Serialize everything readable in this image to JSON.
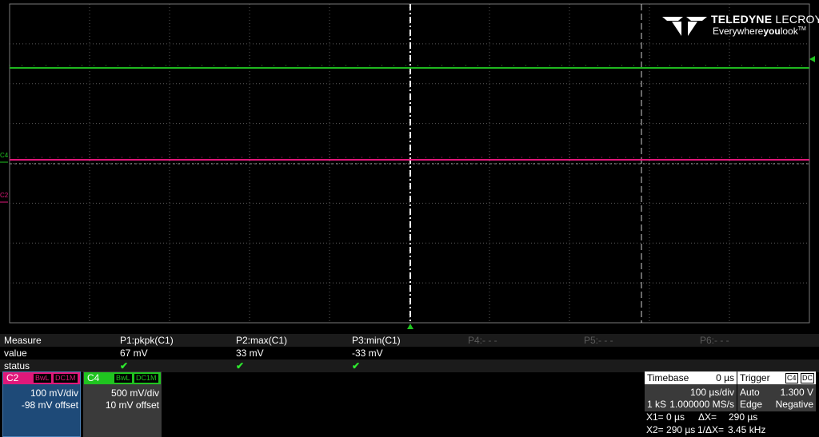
{
  "logo": {
    "brand_bold": "TELEDYNE",
    "brand_thin": "LECROY",
    "tagline_a": "Everywhere",
    "tagline_b": "you",
    "tagline_c": "look",
    "tagline_tm": "TM"
  },
  "traces": {
    "c4_label": "C4",
    "c2_label": "C2",
    "c4_color": "#20c420",
    "c2_color": "#e0187a"
  },
  "measure": {
    "title": "Measure",
    "row_value": "value",
    "row_status": "status",
    "params": [
      {
        "label": "P1:pkpk(C1)",
        "value": "67 mV",
        "ok": "✔"
      },
      {
        "label": "P2:max(C1)",
        "value": "33 mV",
        "ok": "✔"
      },
      {
        "label": "P3:min(C1)",
        "value": "-33 mV",
        "ok": "✔"
      },
      {
        "label": "P4:- - -",
        "value": "",
        "ok": ""
      },
      {
        "label": "P5:- - -",
        "value": "",
        "ok": ""
      },
      {
        "label": "P6:- - -",
        "value": "",
        "ok": ""
      }
    ]
  },
  "channels": {
    "c2": {
      "name": "C2",
      "bw": "BwL",
      "cpl": "DC1M",
      "scale": "100 mV/div",
      "offset": "-98 mV offset"
    },
    "c4": {
      "name": "C4",
      "bw": "BwL",
      "cpl": "DC1M",
      "scale": "500 mV/div",
      "offset": "10 mV offset"
    }
  },
  "timebase": {
    "label": "Timebase",
    "delay": "0 µs",
    "per_div": "100 µs/div",
    "samples": "1 kS",
    "rate": "1.000000 MS/s"
  },
  "trigger": {
    "label": "Trigger",
    "source": "C4",
    "coupling": "DC",
    "mode": "Auto",
    "level": "1.300 V",
    "type": "Edge",
    "slope": "Negative"
  },
  "cursors": {
    "x1": "X1= 0 µs",
    "dx": "ΔX=",
    "dx_val": "290 µs",
    "x2": "X2= 290 µs",
    "inv": "1/ΔX=",
    "inv_val": "3.45 kHz"
  }
}
